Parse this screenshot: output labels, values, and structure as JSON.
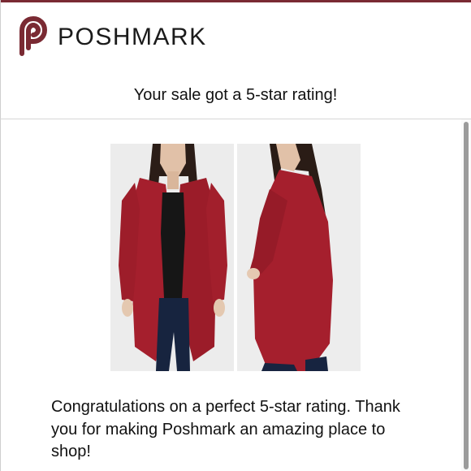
{
  "brand": {
    "name": "POSHMARK",
    "logo_icon": "poshmark-logo-icon",
    "color": "#7a2a33"
  },
  "notice": {
    "text": "Your sale got a 5-star rating!"
  },
  "listing": {
    "images": [
      {
        "icon": "cardigan-front-photo"
      },
      {
        "icon": "cardigan-side-photo"
      }
    ],
    "garment_color": "#a51f2d"
  },
  "message": {
    "text": "Congratulations on a perfect 5-star rating. Thank you for making Poshmark an amazing place to shop!"
  },
  "colors": {
    "accent": "#7a2a33",
    "divider": "#d6d6d6",
    "scrollbar": "#9b9b9b"
  }
}
